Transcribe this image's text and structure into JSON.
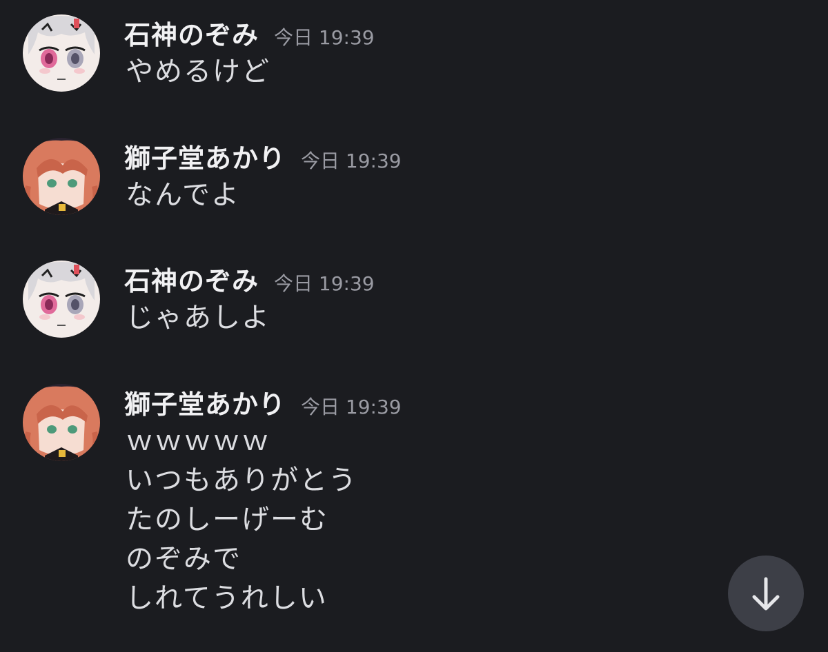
{
  "messages": [
    {
      "author": "石神のぞみ",
      "avatar_icon": "nozomi-avatar",
      "time": "今日 19:39",
      "lines": [
        "やめるけど"
      ]
    },
    {
      "author": "獅子堂あかり",
      "avatar_icon": "akari-avatar",
      "time": "今日 19:39",
      "lines": [
        "なんでよ"
      ]
    },
    {
      "author": "石神のぞみ",
      "avatar_icon": "nozomi-avatar",
      "time": "今日 19:39",
      "lines": [
        "じゃあしよ"
      ]
    },
    {
      "author": "獅子堂あかり",
      "avatar_icon": "akari-avatar",
      "time": "今日 19:39",
      "lines": [
        "ｗｗｗｗｗ",
        "いつもありがとう",
        "たのしーげーむ",
        "のぞみで",
        "しれてうれしい"
      ]
    }
  ],
  "scroll_button": {
    "icon": "arrow-down-icon"
  },
  "colors": {
    "background": "#1b1c20",
    "username": "#f1f1f3",
    "timestamp": "#9a9ba3",
    "message_text": "#dcdde1",
    "scroll_button_bg": "#3d3f47"
  }
}
